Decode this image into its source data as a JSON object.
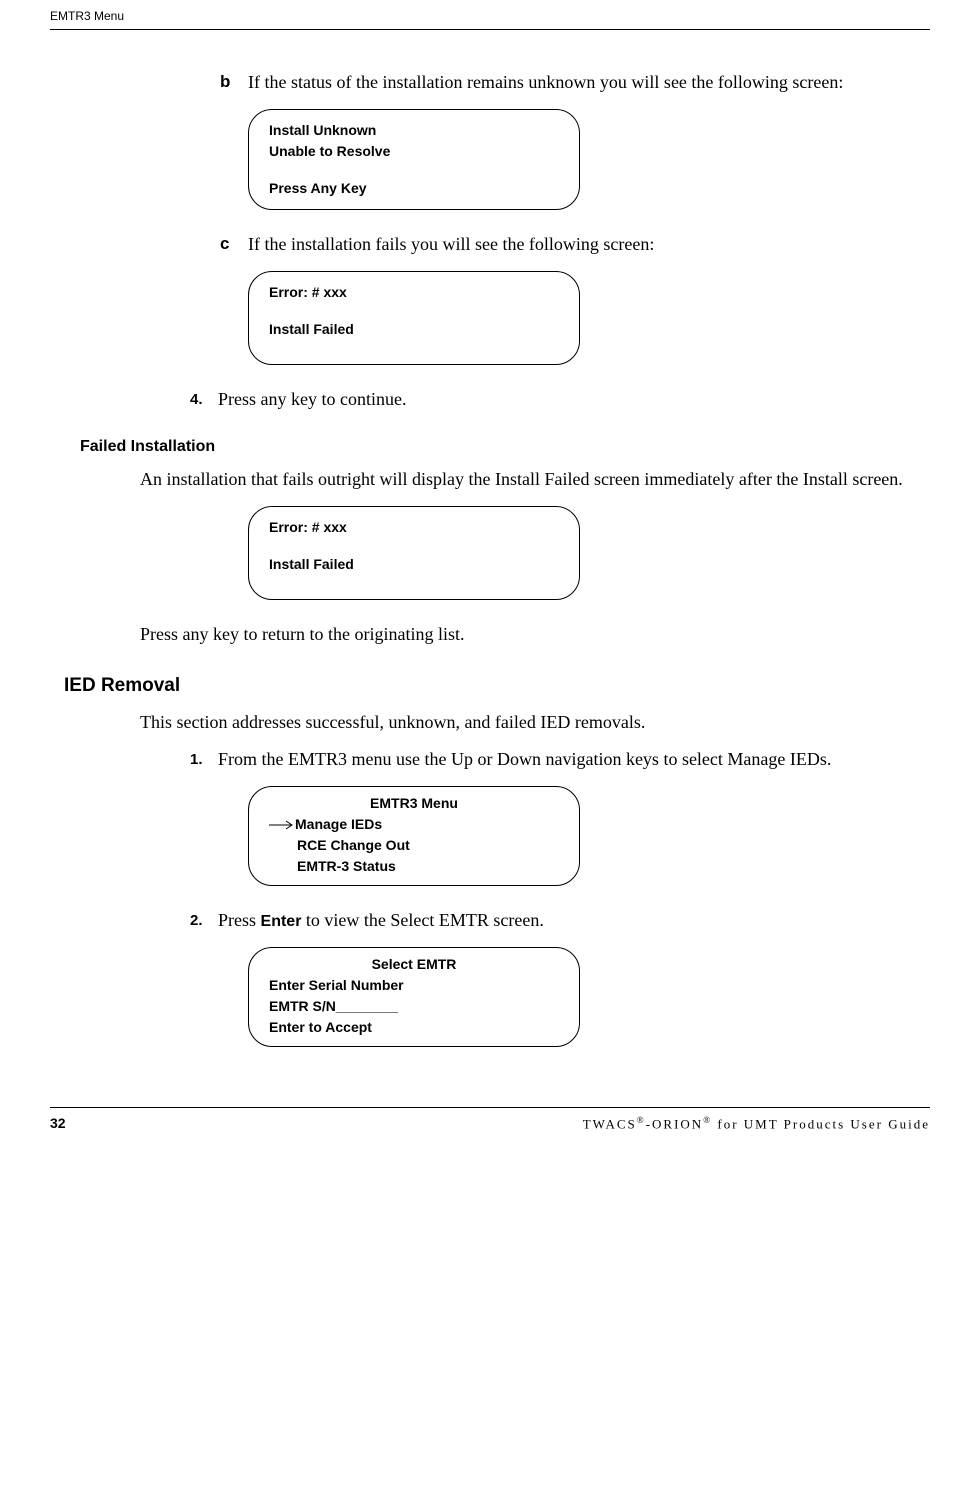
{
  "header": {
    "title": "EMTR3 Menu"
  },
  "items": {
    "b": {
      "bullet": "b",
      "text": "If the status of the installation remains unknown you will see the following screen:"
    },
    "c": {
      "bullet": "c",
      "text": "If the installation fails you will see the following screen:"
    },
    "step4": {
      "bullet": "4.",
      "text": "Press any key to continue."
    },
    "step1": {
      "bullet": "1.",
      "text": "From the EMTR3 menu use the Up or Down navigation keys to select Manage IEDs."
    },
    "step2": {
      "bullet": "2.",
      "pre": "Press ",
      "bold": "Enter",
      "post": " to view the Select EMTR screen."
    }
  },
  "lcd": {
    "unknown": {
      "l1": "Install Unknown",
      "l2": "Unable to Resolve",
      "l3": "Press Any Key"
    },
    "error1": {
      "l1": "Error: # xxx",
      "l2": "Install Failed"
    },
    "error2": {
      "l1": "Error: # xxx",
      "l2": "Install Failed"
    },
    "menu": {
      "title": "EMTR3 Menu",
      "item1": "Manage IEDs",
      "item2": "RCE Change Out",
      "item3": "EMTR-3 Status"
    },
    "select": {
      "title": "Select EMTR",
      "l1": "Enter Serial Number",
      "l2": "EMTR S/N________",
      "l3": "Enter to Accept"
    }
  },
  "sections": {
    "failed_head": "Failed Installation",
    "failed_body": "An installation that fails outright will display the Install Failed screen immediately after the Install screen.",
    "failed_after": "Press any key to return to the originating list.",
    "removal_head": "IED Removal",
    "removal_body": "This section addresses successful, unknown, and failed IED removals."
  },
  "footer": {
    "page": "32",
    "text_pre": "TWACS",
    "reg": "®",
    "text_mid": "-ORION",
    "text_post": " for UMT Products User Guide"
  }
}
